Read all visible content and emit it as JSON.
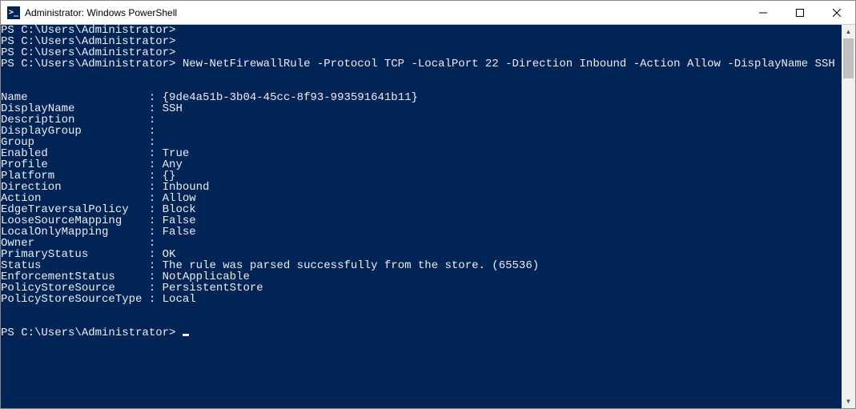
{
  "window": {
    "title": "Administrator: Windows PowerShell",
    "icon_text": ">_"
  },
  "prompts": [
    {
      "prompt": "PS C:\\Users\\Administrator>",
      "command": ""
    },
    {
      "prompt": "PS C:\\Users\\Administrator>",
      "command": ""
    },
    {
      "prompt": "PS C:\\Users\\Administrator>",
      "command": ""
    },
    {
      "prompt": "PS C:\\Users\\Administrator>",
      "command": "New-NetFirewallRule -Protocol TCP -LocalPort 22 -Direction Inbound -Action Allow -DisplayName SSH"
    }
  ],
  "output": [
    {
      "key": "Name",
      "value": "{9de4a51b-3b04-45cc-8f93-993591641b11}"
    },
    {
      "key": "DisplayName",
      "value": "SSH"
    },
    {
      "key": "Description",
      "value": ""
    },
    {
      "key": "DisplayGroup",
      "value": ""
    },
    {
      "key": "Group",
      "value": ""
    },
    {
      "key": "Enabled",
      "value": "True"
    },
    {
      "key": "Profile",
      "value": "Any"
    },
    {
      "key": "Platform",
      "value": "{}"
    },
    {
      "key": "Direction",
      "value": "Inbound"
    },
    {
      "key": "Action",
      "value": "Allow"
    },
    {
      "key": "EdgeTraversalPolicy",
      "value": "Block"
    },
    {
      "key": "LooseSourceMapping",
      "value": "False"
    },
    {
      "key": "LocalOnlyMapping",
      "value": "False"
    },
    {
      "key": "Owner",
      "value": ""
    },
    {
      "key": "PrimaryStatus",
      "value": "OK"
    },
    {
      "key": "Status",
      "value": "The rule was parsed successfully from the store. (65536)"
    },
    {
      "key": "EnforcementStatus",
      "value": "NotApplicable"
    },
    {
      "key": "PolicyStoreSource",
      "value": "PersistentStore"
    },
    {
      "key": "PolicyStoreSourceType",
      "value": "Local"
    }
  ],
  "trailing_prompt": "PS C:\\Users\\Administrator> "
}
